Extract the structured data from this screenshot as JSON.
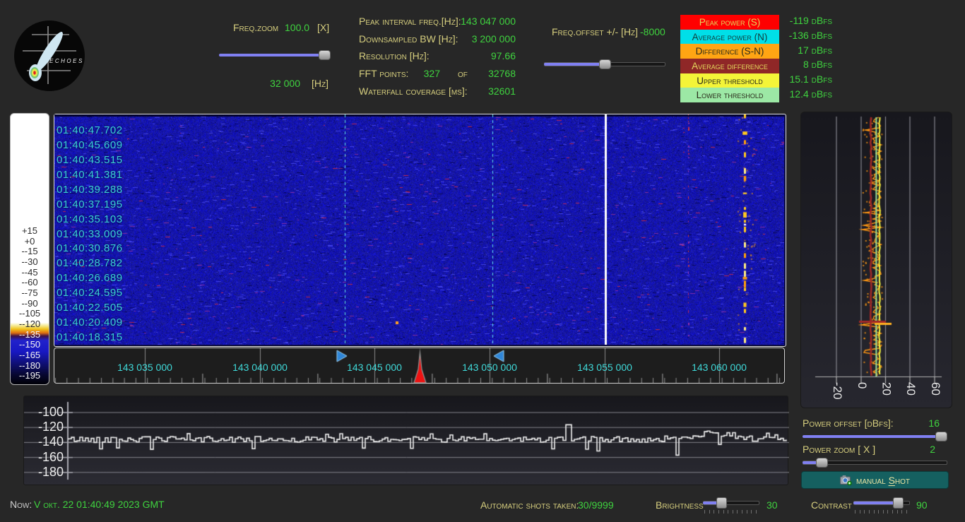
{
  "logo": {
    "text": "ECHOES"
  },
  "header": {
    "freq_zoom": {
      "label": "Freq.zoom",
      "value": "100.0",
      "unit": "[X]",
      "bw_value": "32 000",
      "bw_unit": "[Hz]"
    },
    "info_rows": [
      {
        "label": "Peak interval freq.[Hz]:",
        "value": "143 047 000"
      },
      {
        "label": "Downsampled BW  [Hz]:",
        "value": "3 200 000"
      },
      {
        "label": "Resolution [Hz]:",
        "value": "97.66"
      },
      {
        "label": "FFT points:",
        "value": "327",
        "mid": "of",
        "value2": "32768"
      },
      {
        "label": "Waterfall coverage [ms]:",
        "value": "32601"
      }
    ],
    "freq_offset": {
      "label": "Freq.offset +/- [Hz]",
      "value": "-8000"
    },
    "legend": [
      {
        "label": "Peak power (S)",
        "bg": "#ff0000",
        "fg": "#e3d95c",
        "value": "-119 dBfs"
      },
      {
        "label": "Average power (N)",
        "bg": "#00dfe8",
        "fg": "#123c3c",
        "value": "-136 dBfs"
      },
      {
        "label": "Difference (S-N)",
        "bg": "#ffa513",
        "fg": "#2a2a1a",
        "value": "17 dBfs"
      },
      {
        "label": "Average difference",
        "bg": "#8f2727",
        "fg": "#e3d95c",
        "value": "8 dBfs"
      },
      {
        "label": "Upper threshold",
        "bg": "#f4f438",
        "fg": "#2a2a1a",
        "value": "15.1 dBfs"
      },
      {
        "label": "Lower threshold",
        "bg": "#9ce8a5",
        "fg": "#2a2a1a",
        "value": "12.4 dBfs"
      }
    ]
  },
  "waterfall": {
    "timestamps": [
      "01:40:47.702",
      "01:40:45.609",
      "01:40:43.515",
      "01:40:41.381",
      "01:40:39.288",
      "01:40:37.195",
      "01:40:35.103",
      "01:40:33.009",
      "01:40:30.876",
      "01:40:28.782",
      "01:40:26.689",
      "01:40:24.595",
      "01:40:22.505",
      "01:40:20.409",
      "01:40:18.315"
    ],
    "colorbar_labels": [
      "+15",
      "+0",
      "--15",
      "--30",
      "--45",
      "--60",
      "--75",
      "--90",
      "--105",
      "--120",
      "--135",
      "--150",
      "--165",
      "--180",
      "--195"
    ],
    "freq_ticks": [
      "143 035 000",
      "143 040 000",
      "143 045 000",
      "143 050 000",
      "143 055 000",
      "143 060 000"
    ]
  },
  "histogram": {
    "x_labels": [
      "-20",
      "0",
      "20",
      "40",
      "60"
    ],
    "avg_difference": 8,
    "lower_threshold": 12.4,
    "upper_threshold": 15.1,
    "difference": 17
  },
  "spectrum": {
    "y_labels": [
      "-100",
      "-120",
      "-140",
      "-160",
      "-180"
    ]
  },
  "controls": {
    "power_offset": {
      "label": "Power offset [dBfs]:",
      "value": "16"
    },
    "power_zoom": {
      "label": "Power zoom  [ X ]",
      "value": "2"
    },
    "manual_shot": {
      "prefix": "manual",
      "s": "S",
      "rest": "hot"
    },
    "now": {
      "label": "Now:",
      "value": "V окт. 22 01:40:49 2023 GMT"
    },
    "shots": {
      "label": "Automatic shots taken:",
      "value": "30/9999"
    },
    "brightness": {
      "label": "Brightness",
      "value": "30"
    },
    "contrast": {
      "label": "Contrast",
      "value": "90"
    }
  },
  "colors": {
    "label": "#d6ce7e",
    "value_green": "#3fd33f",
    "timestamp_cyan": "#3ad2d2",
    "slider_blue": "#8080f2",
    "button_teal": "#156060"
  }
}
